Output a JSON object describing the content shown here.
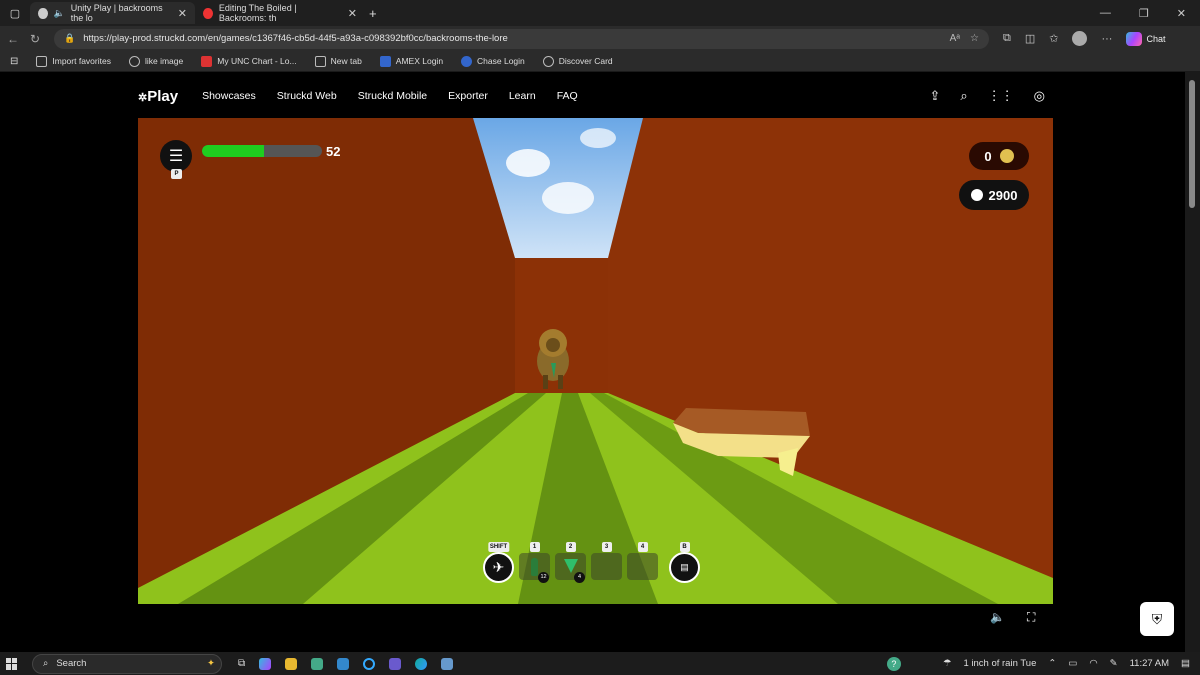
{
  "browser": {
    "tabs": [
      {
        "title": "Unity Play | backrooms the lo"
      },
      {
        "title": "Editing The Boiled | Backrooms: th"
      }
    ],
    "new_tab_glyph": "+",
    "url": "https://play-prod.struckd.com/en/games/c1367f46-cb5d-44f5-a93a-c098392bf0cc/backrooms-the-lore",
    "chat_label": "Chat",
    "bookmarks": [
      "Import favorites",
      "like image",
      "My UNC Chart - Lo...",
      "New tab",
      "AMEX Login",
      "Chase Login",
      "Discover Card"
    ]
  },
  "site": {
    "logo": "Play",
    "nav": [
      "Showcases",
      "Struckd Web",
      "Struckd Mobile",
      "Exporter",
      "Learn",
      "FAQ"
    ]
  },
  "game": {
    "menu_key": "P",
    "health": 52,
    "health_max": 100,
    "coins": "0",
    "points": "2900",
    "hotbar": [
      {
        "key": "SHIFT",
        "type": "sprint",
        "count": ""
      },
      {
        "key": "1",
        "type": "bottle",
        "count": "12"
      },
      {
        "key": "2",
        "type": "crystal",
        "count": "4"
      },
      {
        "key": "3",
        "type": "empty",
        "count": ""
      },
      {
        "key": "4",
        "type": "empty",
        "count": ""
      },
      {
        "key": "B",
        "type": "shop",
        "count": ""
      }
    ],
    "colors": {
      "wall": "#882f05",
      "floor_light": "#8fc21c",
      "floor_dark": "#5d8a10",
      "health": "#1fcd1f"
    }
  },
  "taskbar": {
    "search_label": "Search",
    "weather": "1 inch of rain Tue",
    "time": "11:27 AM"
  }
}
